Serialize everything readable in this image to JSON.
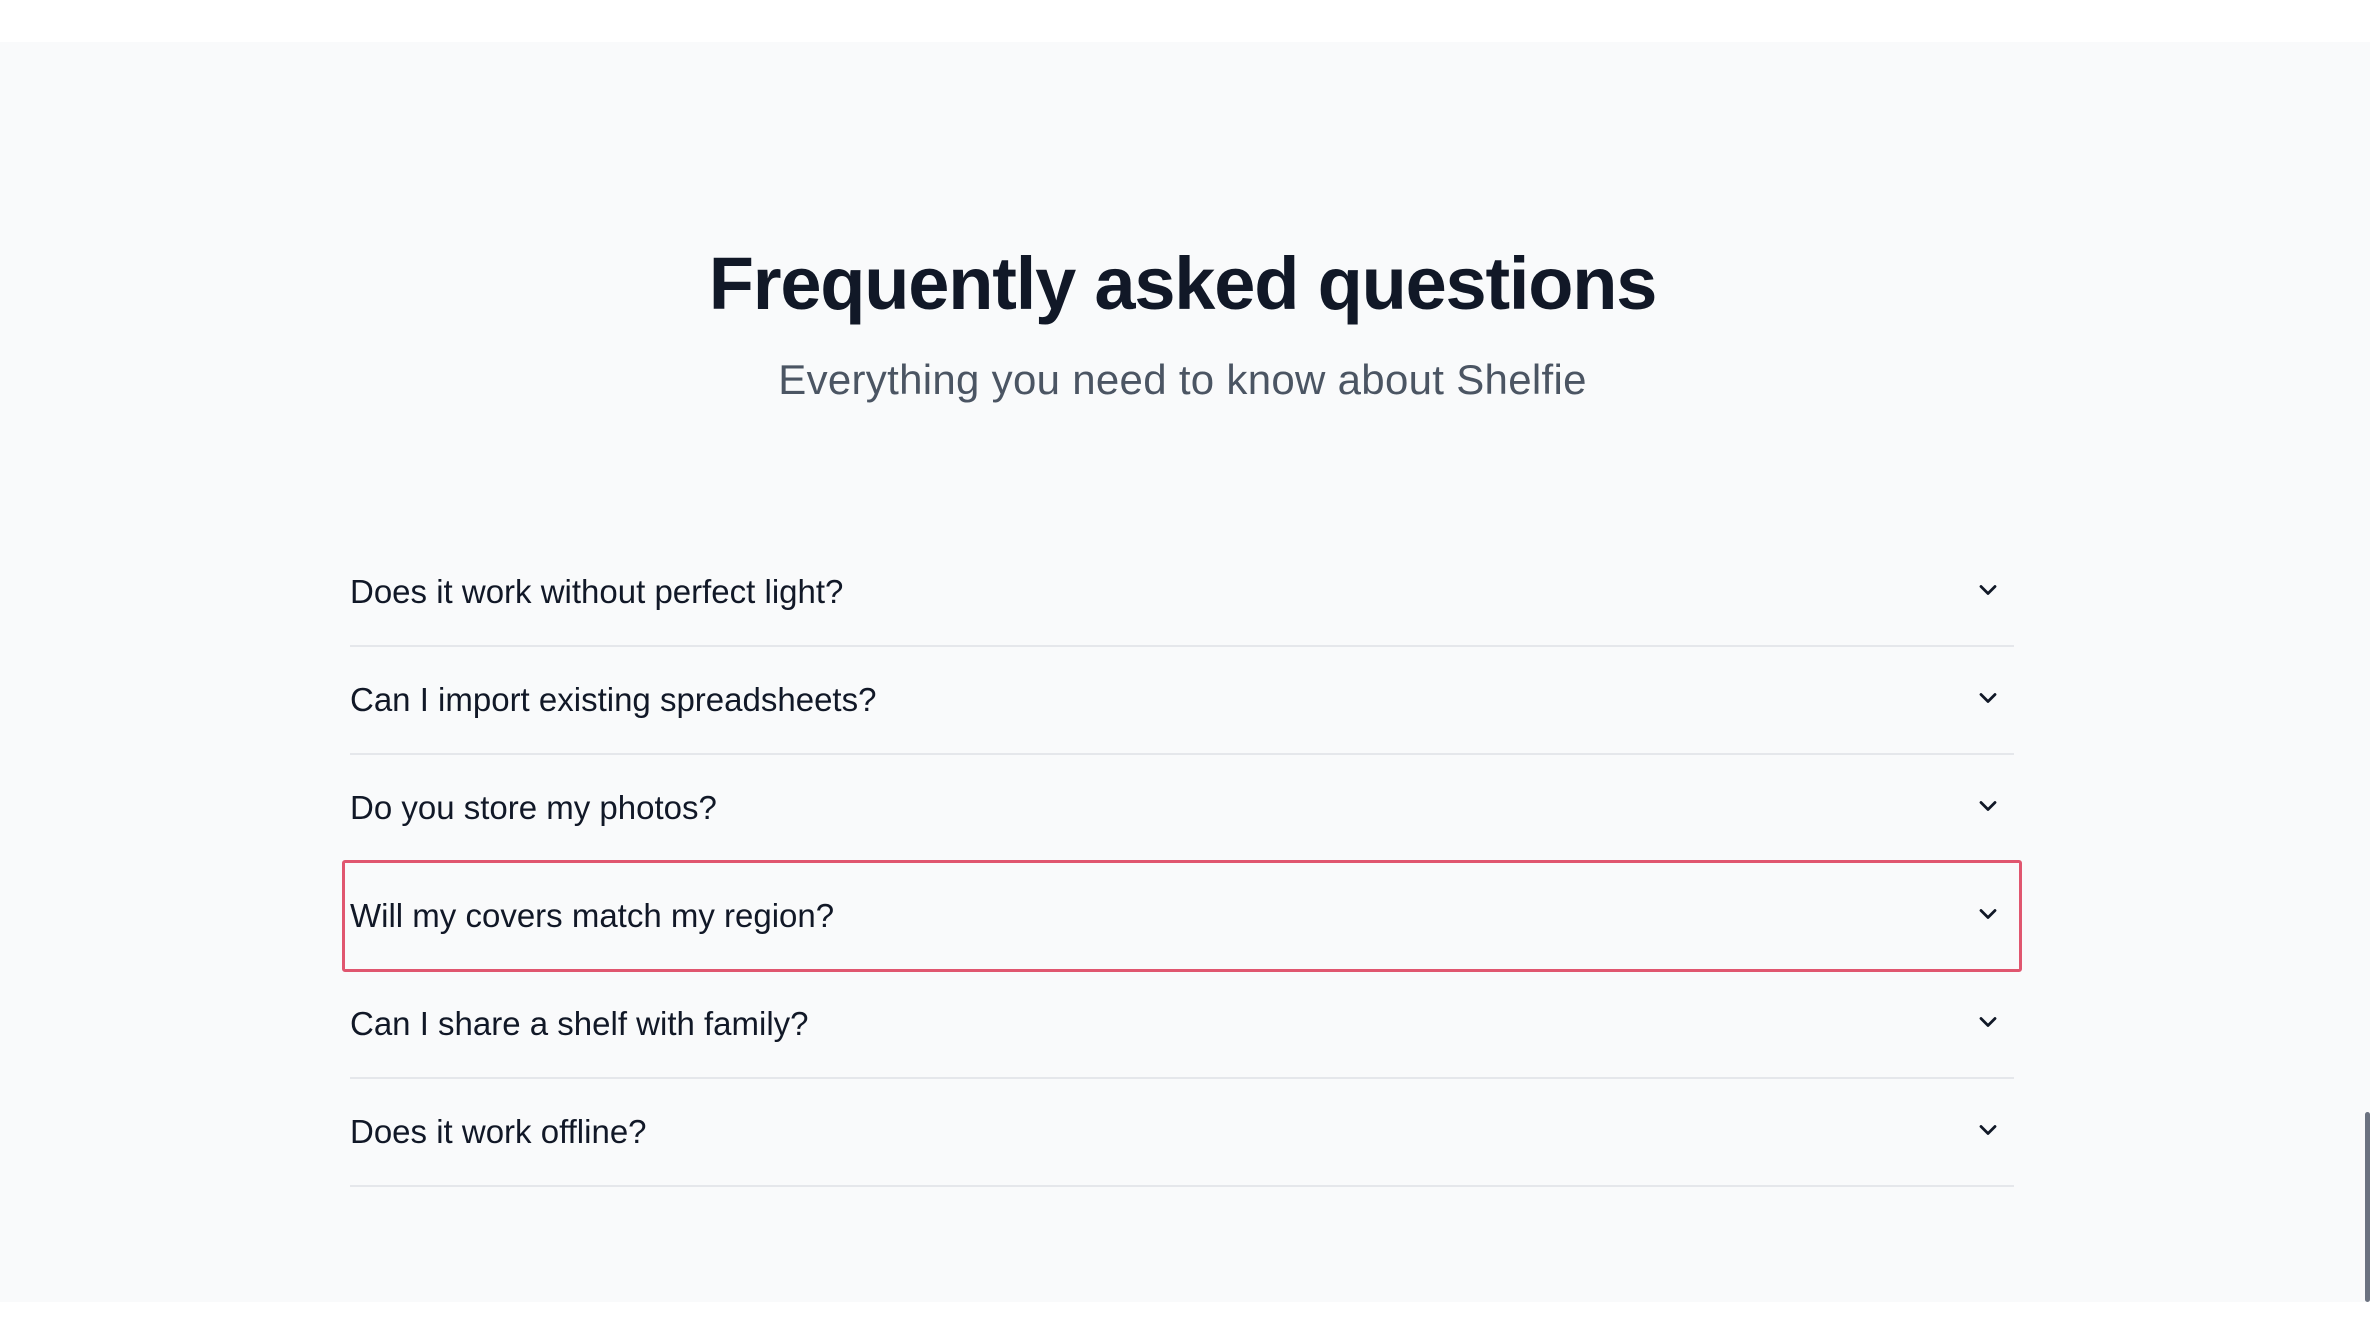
{
  "faq": {
    "title": "Frequently asked questions",
    "subtitle": "Everything you need to know about Shelfie",
    "items": [
      {
        "question": "Does it work without perfect light?"
      },
      {
        "question": "Can I import existing spreadsheets?"
      },
      {
        "question": "Do you store my photos?"
      },
      {
        "question": "Will my covers match my region?"
      },
      {
        "question": "Can I share a shelf with family?"
      },
      {
        "question": "Does it work offline?"
      }
    ],
    "focused_index": 3,
    "icon": "chevron-down-icon"
  },
  "colors": {
    "page_bg": "#ffffff",
    "section_bg": "#f9fafb",
    "title": "#111827",
    "subtitle": "#4b5563",
    "divider": "#e5e7eb",
    "focus_ring": "#e0566f"
  }
}
